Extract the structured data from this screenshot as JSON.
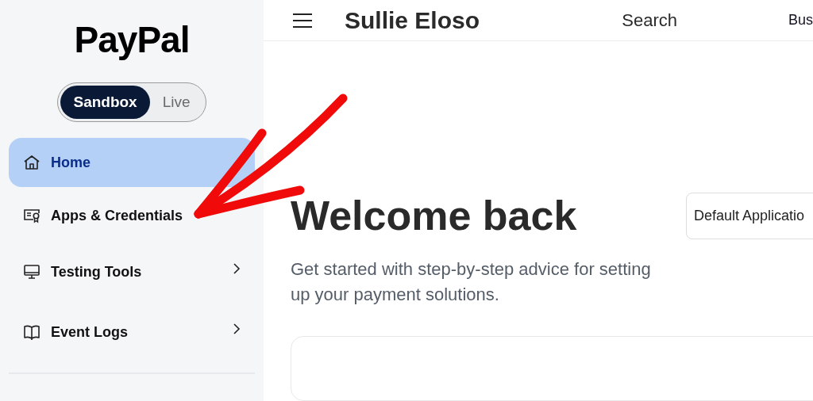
{
  "sidebar": {
    "logo": "PayPal",
    "environment_toggle": [
      {
        "label": "Sandbox",
        "selected": true
      },
      {
        "label": "Live",
        "selected": false
      }
    ],
    "items": [
      {
        "label": "Home",
        "selected": true,
        "expandable": false
      },
      {
        "label": "Apps & Credentials",
        "selected": false,
        "expandable": false
      },
      {
        "label": "Testing Tools",
        "selected": false,
        "expandable": true
      },
      {
        "label": "Event Logs",
        "selected": false,
        "expandable": true
      }
    ]
  },
  "header": {
    "account_name": "Sullie Eloso",
    "search": "Search",
    "column_3": "Bus"
  },
  "main": {
    "title": "Welcome back",
    "subtitle": "Get started with step-by-step advice for setting up your payment solutions.",
    "app_select": "Default Applicatio"
  },
  "annotation": {
    "kind": "arrow"
  }
}
